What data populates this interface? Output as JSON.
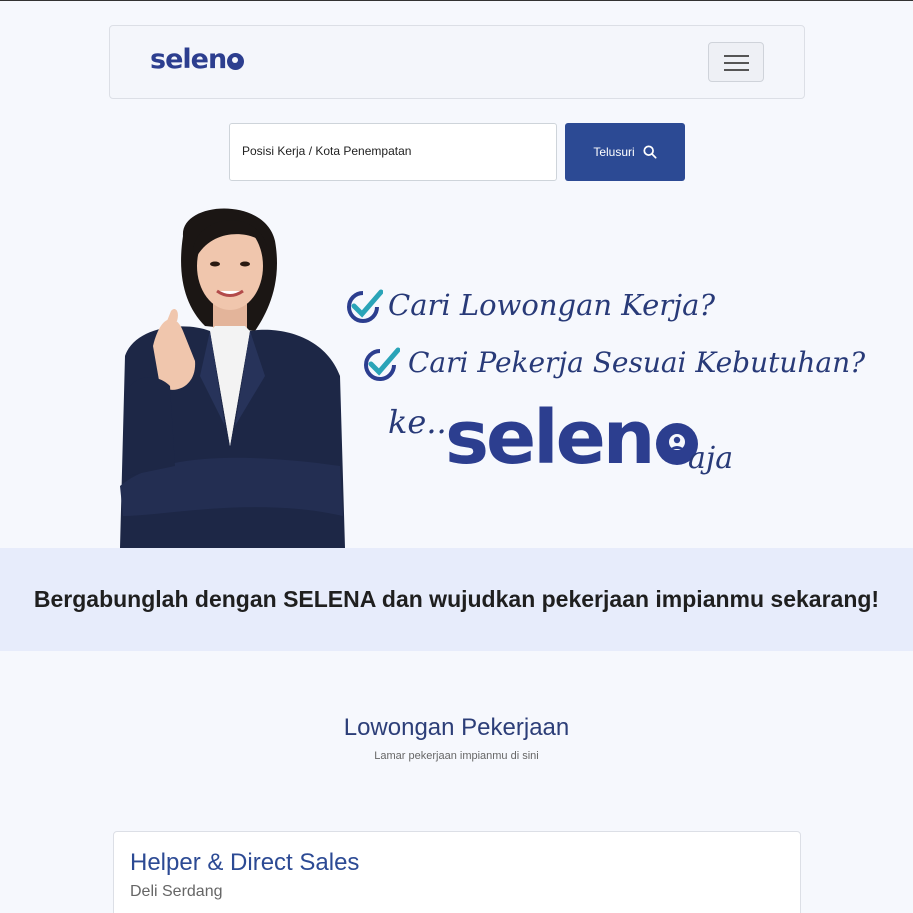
{
  "navbar": {
    "brand": "selen",
    "menu_icon": "hamburger-menu-icon"
  },
  "search": {
    "placeholder": "Posisi Kerja / Kota Penempatan",
    "button_label": "Telusuri",
    "button_icon": "search-icon"
  },
  "hero": {
    "line1": "Cari Lowongan Kerja?",
    "line2": "Cari Pekerja Sesuai Kebutuhan?",
    "ke": "ke...",
    "logo": "selen",
    "aja": "aja",
    "check_icon": "check-badge-icon"
  },
  "banner": {
    "text": "Bergabunglah dengan SELENA dan wujudkan pekerjaan impianmu sekarang!"
  },
  "jobs_section": {
    "title": "Lowongan Pekerjaan",
    "subtitle": "Lamar pekerjaan impianmu di sini",
    "items": [
      {
        "title": "Helper & Direct Sales",
        "location": "Deli Serdang"
      }
    ]
  },
  "colors": {
    "brand": "#2c3e8f",
    "button": "#2c4a94",
    "banner_bg": "#e7ecfb",
    "page_bg": "#f6f8fd"
  }
}
